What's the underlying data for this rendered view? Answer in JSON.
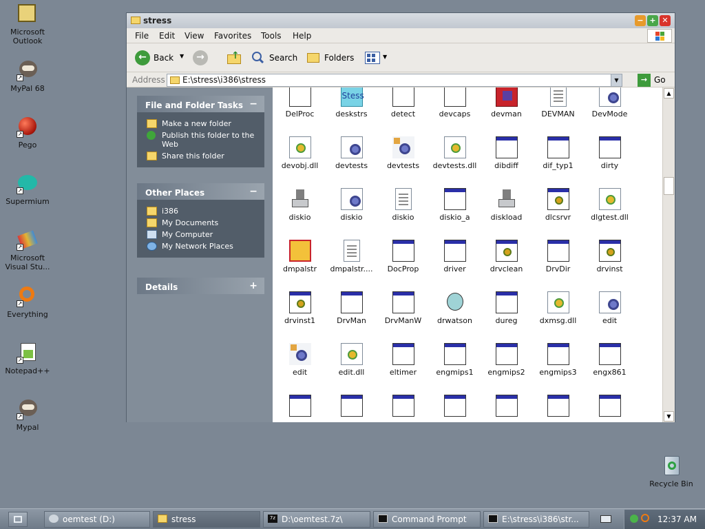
{
  "desktop": {
    "icons": [
      {
        "label": "Microsoft\nOutlook"
      },
      {
        "label": "MyPal 68"
      },
      {
        "label": "Pego"
      },
      {
        "label": "Supermium"
      },
      {
        "label": "Microsoft\nVisual Stu..."
      },
      {
        "label": "Everything"
      },
      {
        "label": "Notepad++"
      },
      {
        "label": "Mypal"
      },
      {
        "label": "Recycle Bin"
      }
    ]
  },
  "window": {
    "title": "stress",
    "menu": [
      "File",
      "Edit",
      "View",
      "Favorites",
      "Tools",
      "Help"
    ],
    "toolbar": {
      "back_label": "Back",
      "search_label": "Search",
      "folders_label": "Folders"
    },
    "address": {
      "label": "Address",
      "value": "E:\\stress\\i386\\stress",
      "go_label": "Go"
    },
    "panels": {
      "tasks": {
        "title": "File and Folder Tasks",
        "toggle": "−",
        "items": [
          "Make a new folder",
          "Publish this folder to the Web",
          "Share this folder"
        ]
      },
      "places": {
        "title": "Other Places",
        "toggle": "−",
        "items": [
          "i386",
          "My Documents",
          "My Computer",
          "My Network Places"
        ]
      },
      "details": {
        "title": "Details",
        "toggle": "+"
      }
    },
    "files": [
      {
        "name": "DelProc",
        "icon": "blank-doc-icon"
      },
      {
        "name": "deskstrs",
        "icon": "stress-app-icon"
      },
      {
        "name": "detect",
        "icon": "blank-doc-icon"
      },
      {
        "name": "devcaps",
        "icon": "blank-doc-icon"
      },
      {
        "name": "devman",
        "icon": "devman-icon"
      },
      {
        "name": "DEVMAN",
        "icon": "text-doc-icon"
      },
      {
        "name": "DevMode",
        "icon": "gear-doc-icon"
      },
      {
        "name": "devobj.dll",
        "icon": "dll-icon"
      },
      {
        "name": "devtests",
        "icon": "gear-doc-icon"
      },
      {
        "name": "devtests",
        "icon": "gear-script-icon"
      },
      {
        "name": "devtests.dll",
        "icon": "dll-icon"
      },
      {
        "name": "dibdiff",
        "icon": "window-app-icon"
      },
      {
        "name": "dif_typ1",
        "icon": "window-app-icon"
      },
      {
        "name": "dirty",
        "icon": "window-app-icon"
      },
      {
        "name": "diskio",
        "icon": "disk-tool-icon"
      },
      {
        "name": "diskio",
        "icon": "gear-doc-icon"
      },
      {
        "name": "diskio",
        "icon": "text-doc-icon"
      },
      {
        "name": "diskio_a",
        "icon": "window-app-icon"
      },
      {
        "name": "diskload",
        "icon": "disk-tool-icon"
      },
      {
        "name": "dlcsrvr",
        "icon": "gear-window-icon"
      },
      {
        "name": "dlgtest.dll",
        "icon": "dll-icon"
      },
      {
        "name": "dmpalstr",
        "icon": "dmpalstr-icon"
      },
      {
        "name": "dmpalstr....",
        "icon": "text-doc-icon"
      },
      {
        "name": "DocProp",
        "icon": "window-app-icon"
      },
      {
        "name": "driver",
        "icon": "window-app-icon"
      },
      {
        "name": "drvclean",
        "icon": "gear-window-icon"
      },
      {
        "name": "DrvDir",
        "icon": "window-app-icon"
      },
      {
        "name": "drvinst",
        "icon": "gear-window-icon"
      },
      {
        "name": "drvinst1",
        "icon": "gear-window-icon"
      },
      {
        "name": "DrvMan",
        "icon": "window-app-icon"
      },
      {
        "name": "DrvManW",
        "icon": "window-app-icon"
      },
      {
        "name": "drwatson",
        "icon": "drwatson-icon"
      },
      {
        "name": "dureg",
        "icon": "window-app-icon"
      },
      {
        "name": "dxmsg.dll",
        "icon": "dll-icon"
      },
      {
        "name": "edit",
        "icon": "gear-doc-icon"
      },
      {
        "name": "edit",
        "icon": "gear-script-icon"
      },
      {
        "name": "edit.dll",
        "icon": "dll-icon"
      },
      {
        "name": "eltimer",
        "icon": "window-app-icon"
      },
      {
        "name": "engmips1",
        "icon": "window-app-icon"
      },
      {
        "name": "engmips2",
        "icon": "window-app-icon"
      },
      {
        "name": "engmips3",
        "icon": "window-app-icon"
      },
      {
        "name": "engx861",
        "icon": "window-app-icon"
      },
      {
        "name": "",
        "icon": "window-app-icon"
      },
      {
        "name": "",
        "icon": "window-app-icon"
      },
      {
        "name": "",
        "icon": "window-app-icon"
      },
      {
        "name": "",
        "icon": "window-app-icon"
      },
      {
        "name": "",
        "icon": "window-app-icon"
      },
      {
        "name": "",
        "icon": "window-app-icon"
      },
      {
        "name": "",
        "icon": "window-app-icon"
      }
    ]
  },
  "taskbar": {
    "tasks": [
      {
        "label": "oemtest (D:)"
      },
      {
        "label": "stress"
      },
      {
        "label": "D:\\oemtest.7z\\"
      },
      {
        "label": "Command Prompt"
      },
      {
        "label": "E:\\stress\\i386\\str..."
      }
    ],
    "clock": "12:37 AM"
  }
}
